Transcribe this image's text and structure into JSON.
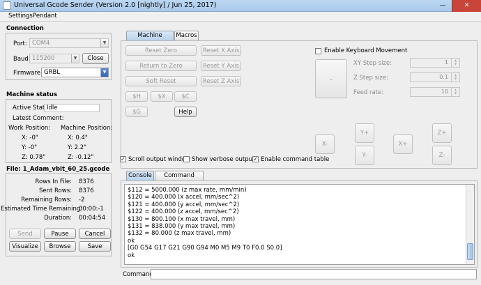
{
  "window": {
    "title": "Universal Gcode Sender (Version 2.0 [nightly]  / Jun 25, 2017)",
    "minimize_glyph": "—",
    "close_glyph": "✕"
  },
  "menu": {
    "items": [
      "Settings",
      "Pendant"
    ]
  },
  "connection": {
    "title": "Connection",
    "port_label": "Port:",
    "port_value": "COM4",
    "baud_label": "Baud:",
    "baud_value": "115200",
    "close_button": "Close",
    "firmware_label": "Firmware:",
    "firmware_value": "GRBL"
  },
  "machine_status": {
    "title": "Machine status",
    "active_state_label": "Active State:",
    "active_state_value": "Idle",
    "latest_comment_label": "Latest Comment:",
    "work_position_label": "Work Position:",
    "machine_position_label": "Machine Position:",
    "work": {
      "x": "X:  -0\"",
      "y": "Y:  -0\"",
      "z": "Z:  0.78\""
    },
    "machine": {
      "x": "X:  0.4\"",
      "y": "Y:  2.2\"",
      "z": "Z:  -0.12\""
    }
  },
  "file": {
    "title": "File: 1_Adam_vbit_60_25.gcode",
    "rows": [
      {
        "label": "Rows In File:",
        "value": "8376"
      },
      {
        "label": "Sent Rows:",
        "value": "8376"
      },
      {
        "label": "Remaining Rows:",
        "value": "-2"
      },
      {
        "label": "Estimated Time Remaining:",
        "value": "00:00:-1"
      },
      {
        "label": "Duration:",
        "value": "00:04:54"
      }
    ],
    "buttons": {
      "send": "Send",
      "pause": "Pause",
      "cancel": "Cancel",
      "visualize": "Visualize",
      "browse": "Browse",
      "save": "Save"
    }
  },
  "machine_control": {
    "tabs": [
      "Machine Control",
      "Macros"
    ],
    "reset_zero": "Reset Zero",
    "return_to_zero": "Return to Zero",
    "soft_reset": "Soft Reset",
    "reset_x": "Reset X Axis",
    "reset_y": "Reset Y Axis",
    "reset_z": "Reset Z Axis",
    "cmd_h": "$H",
    "cmd_x": "$X",
    "cmd_c": "$C",
    "cmd_g": "$G",
    "help": "Help",
    "enable_keyboard": "Enable Keyboard Movement",
    "xy_step_label": "XY Step size:",
    "xy_step_value": "1",
    "z_step_label": "Z Step size:",
    "z_step_value": "0.1",
    "feed_rate_label": "Feed rate:",
    "feed_rate_value": "10",
    "jog_center": "-",
    "jog_x_minus": "X-",
    "jog_x_plus": "X+",
    "jog_y_plus": "Y+",
    "jog_y_minus": "Y-",
    "jog_z_plus": "Z+",
    "jog_z_minus": "Z-"
  },
  "options": {
    "scroll_output": {
      "label": "Scroll output window",
      "checked": true
    },
    "verbose_output": {
      "label": "Show verbose output",
      "checked": false
    },
    "command_table": {
      "label": "Enable command table",
      "checked": true
    }
  },
  "console": {
    "tabs": [
      "Console",
      "Command Table"
    ],
    "lines": [
      "$112 = 5000.000    (z max rate, mm/min)",
      "$120 = 400.000    (x accel, mm/sec^2)",
      "$121 = 400.000    (y accel, mm/sec^2)",
      "$122 = 400.000    (z accel, mm/sec^2)",
      "$130 = 800.100    (x max travel, mm)",
      "$131 = 838.000    (y max travel, mm)",
      "$132 = 80.000    (z max travel, mm)",
      "ok",
      "[G0 G54 G17 G21 G90 G94 M0 M5 M9 T0 F0.0 S0.0]",
      "ok"
    ],
    "command_label": "Command:"
  }
}
